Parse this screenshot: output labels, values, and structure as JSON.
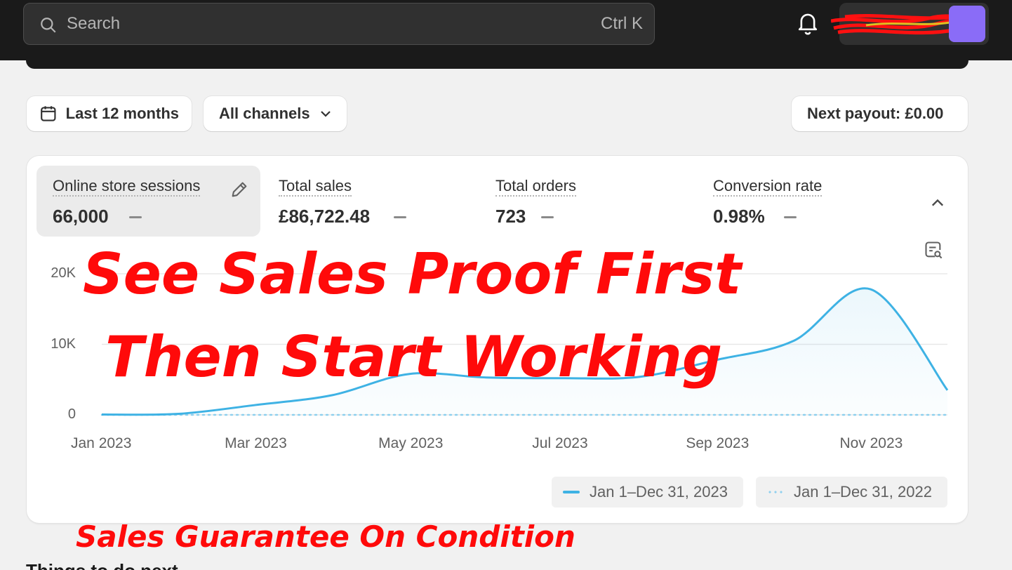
{
  "search": {
    "placeholder": "Search",
    "shortcut": "Ctrl K"
  },
  "topbar": {
    "account_name": ""
  },
  "filters": {
    "date_range": "Last 12 months",
    "channels": "All channels",
    "payout": "Next payout: £0.00"
  },
  "metrics": [
    {
      "label": "Online store sessions",
      "value": "66,000"
    },
    {
      "label": "Total sales",
      "value": "£86,722.48"
    },
    {
      "label": "Total orders",
      "value": "723"
    },
    {
      "label": "Conversion rate",
      "value": "0.98%"
    }
  ],
  "chart_data": {
    "type": "area",
    "x": [
      "Jan 2023",
      "Feb 2023",
      "Mar 2023",
      "Apr 2023",
      "May 2023",
      "Jun 2023",
      "Jul 2023",
      "Aug 2023",
      "Sep 2023",
      "Oct 2023",
      "Nov 2023",
      "Dec 2023"
    ],
    "xticks": [
      "Jan 2023",
      "Mar 2023",
      "May 2023",
      "Jul 2023",
      "Sep 2023",
      "Nov 2023"
    ],
    "yticks": [
      "20K",
      "10K",
      "0"
    ],
    "ylim": [
      0,
      20000
    ],
    "grid": true,
    "legend_position": "bottom-right",
    "series": [
      {
        "name": "Jan 1–Dec 31, 2023",
        "style": "solid",
        "color": "#3eb2e4",
        "values": [
          50,
          150,
          1400,
          2800,
          5800,
          5300,
          5200,
          5400,
          7800,
          10500,
          17800,
          3500
        ]
      },
      {
        "name": "Jan 1–Dec 31, 2022",
        "style": "dotted",
        "color": "#8fd0ee",
        "values": [
          0,
          0,
          0,
          0,
          0,
          0,
          0,
          0,
          0,
          0,
          0,
          0
        ]
      }
    ]
  },
  "overlay": {
    "line1": "See Sales Proof First",
    "line2": "Then Start Working",
    "line3": "Sales Guarantee On Condition"
  },
  "below": {
    "heading": "Things to do next"
  },
  "colors": {
    "overlay_red": "#ff0a0a",
    "series_blue": "#3eb2e4",
    "avatar": "#8a6cf7",
    "topbar": "#1a1a1a"
  }
}
